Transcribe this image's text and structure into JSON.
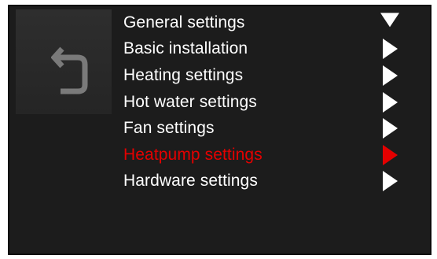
{
  "colors": {
    "panel_background": "#1c1c1c",
    "text_default": "#ffffff",
    "text_active": "#e40000",
    "arrow_default": "#ffffff",
    "arrow_active": "#e40000"
  },
  "back_button": {
    "icon": "return-arrow-icon"
  },
  "menu": {
    "items": [
      {
        "label": "General settings",
        "icon": "triangle-down-icon",
        "active": false
      },
      {
        "label": "Basic installation",
        "icon": "triangle-right-icon",
        "active": false
      },
      {
        "label": "Heating settings",
        "icon": "triangle-right-icon",
        "active": false
      },
      {
        "label": "Hot water settings",
        "icon": "triangle-right-icon",
        "active": false
      },
      {
        "label": "Fan settings",
        "icon": "triangle-right-icon",
        "active": false
      },
      {
        "label": "Heatpump settings",
        "icon": "triangle-right-icon",
        "active": true
      },
      {
        "label": "Hardware settings",
        "icon": "triangle-right-icon",
        "active": false
      }
    ]
  }
}
